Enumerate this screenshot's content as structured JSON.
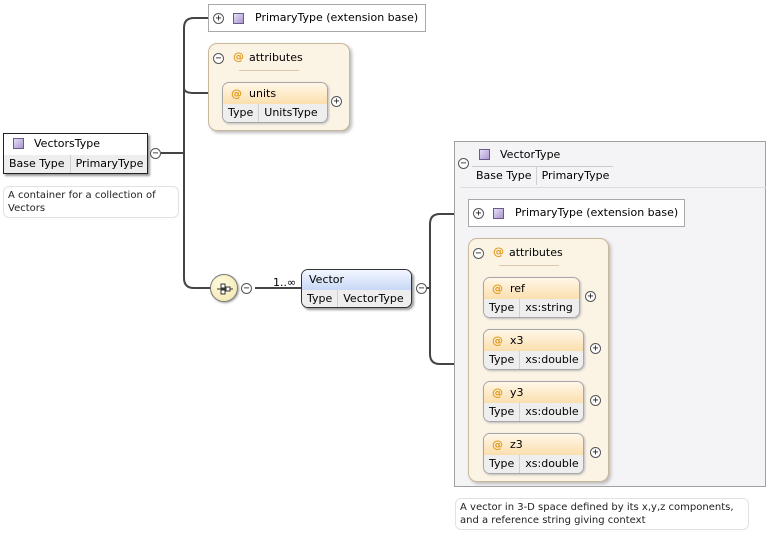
{
  "vectors_type": {
    "name": "VectorsType",
    "base_type_label": "Base Type",
    "base_type_value": "PrimaryType"
  },
  "vectors_note": "A container for a collection of Vectors",
  "primary_ext_top": {
    "label": "PrimaryType (extension base)"
  },
  "attributes_top": {
    "title": "attributes",
    "items": [
      {
        "name": "units",
        "type_label": "Type",
        "type_value": "UnitsType"
      }
    ]
  },
  "vector_element": {
    "name": "Vector",
    "type_label": "Type",
    "type_value": "VectorType",
    "cardinality": "1..∞"
  },
  "vector_type": {
    "name": "VectorType",
    "base_type_label": "Base Type",
    "base_type_value": "PrimaryType"
  },
  "primary_ext_inner": {
    "label": "PrimaryType (extension base)"
  },
  "attributes_inner": {
    "title": "attributes",
    "items": [
      {
        "name": "ref",
        "type_label": "Type",
        "type_value": "xs:string"
      },
      {
        "name": "x3",
        "type_label": "Type",
        "type_value": "xs:double"
      },
      {
        "name": "y3",
        "type_label": "Type",
        "type_value": "xs:double"
      },
      {
        "name": "z3",
        "type_label": "Type",
        "type_value": "xs:double"
      }
    ]
  },
  "vector_note": "A vector in 3-D space defined by its x,y,z components, and a reference string giving context",
  "symbols": {
    "at": "@",
    "plus": "+",
    "minus": "−"
  },
  "colors": {
    "attribute_bg": "#fbf3e4",
    "attribute_header": "#fbdfae",
    "element_header": "#c7d8f6",
    "type_square": "#a997cf",
    "at_symbol": "#e29b1f"
  }
}
